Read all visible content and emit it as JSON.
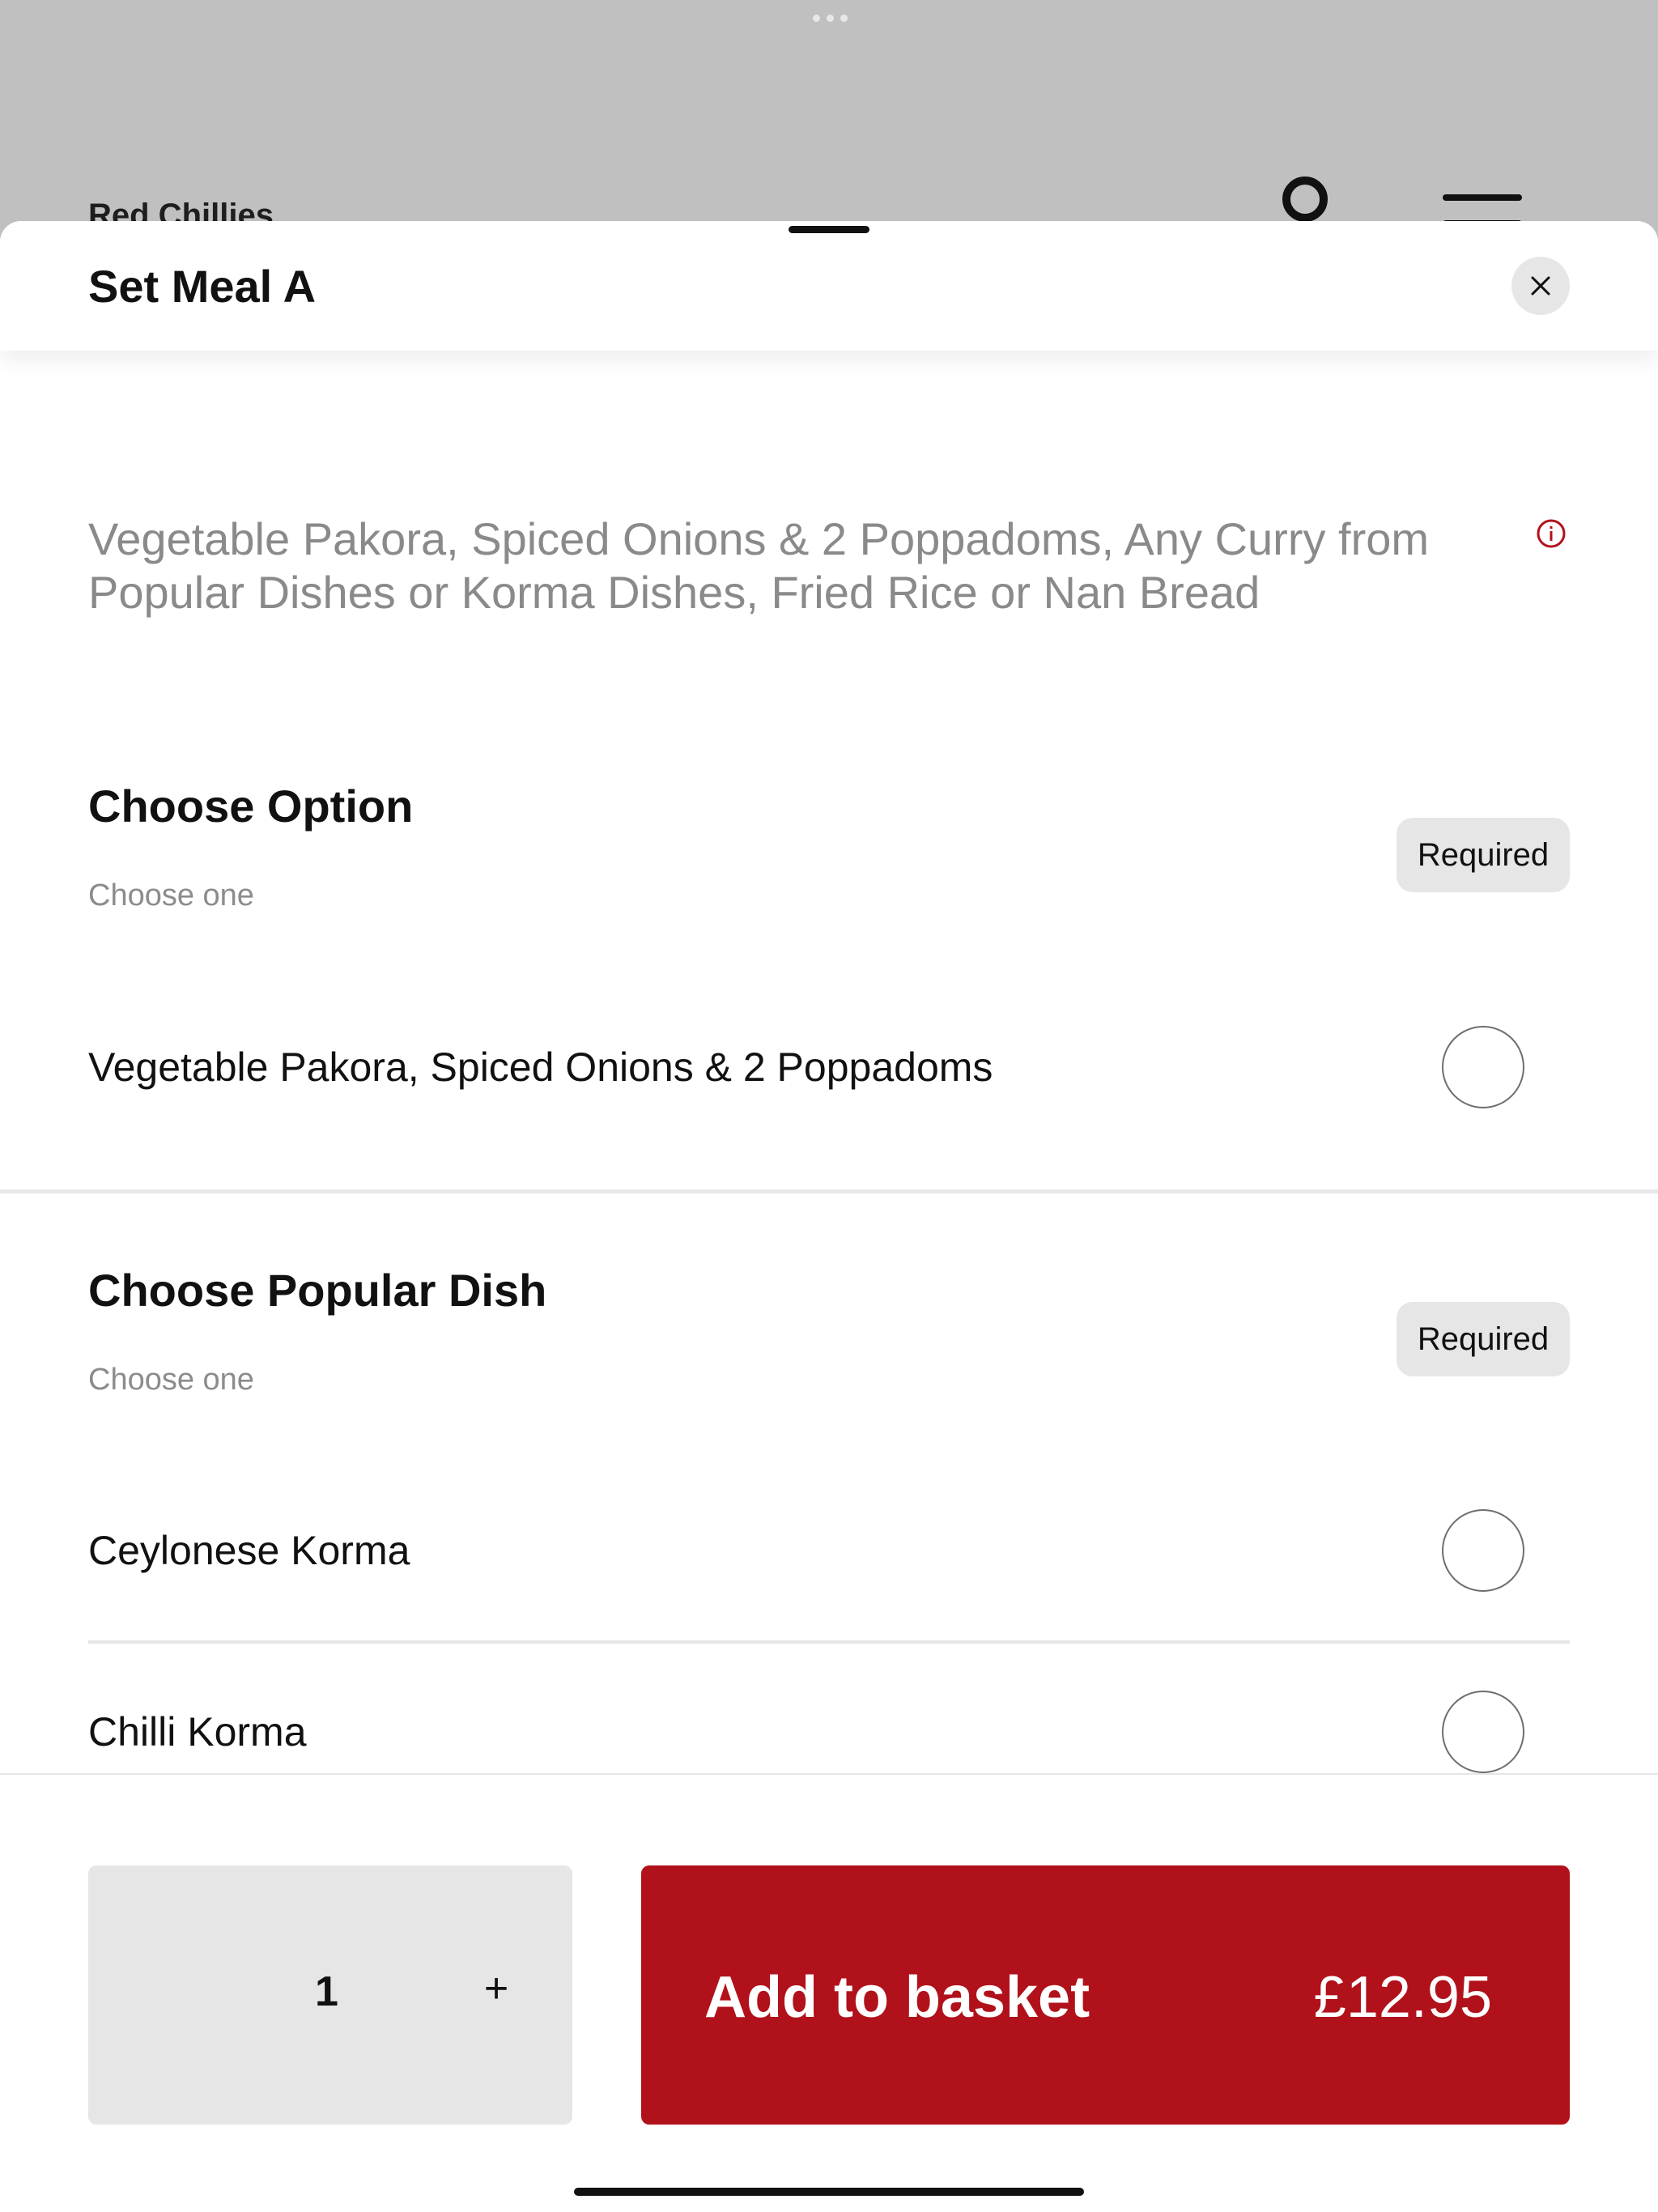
{
  "background": {
    "restaurant_name": "Red Chillies",
    "icons": [
      "more-dots-icon",
      "search-icon",
      "menu-icon"
    ]
  },
  "sheet": {
    "title": "Set Meal A",
    "close_icon": "close-icon",
    "description": "Vegetable Pakora, Spiced Onions & 2 Poppadoms, Any Curry from Popular Dishes or Korma Dishes, Fried Rice or Nan Bread",
    "info_icon": "info-icon"
  },
  "groups": [
    {
      "title": "Choose Option",
      "subtitle": "Choose one",
      "badge": "Required",
      "options": [
        "Vegetable Pakora, Spiced Onions & 2 Poppadoms"
      ]
    },
    {
      "title": "Choose Popular Dish",
      "subtitle": "Choose one",
      "badge": "Required",
      "options": [
        "Ceylonese Korma",
        "Chilli Korma"
      ]
    }
  ],
  "footer": {
    "quantity": "1",
    "plus_label": "+",
    "add_label": "Add to basket",
    "price": "£12.95"
  },
  "colors": {
    "accent": "#b1111a",
    "backdrop": "#c0c0c0",
    "badge_bg": "#e6e6e6"
  }
}
